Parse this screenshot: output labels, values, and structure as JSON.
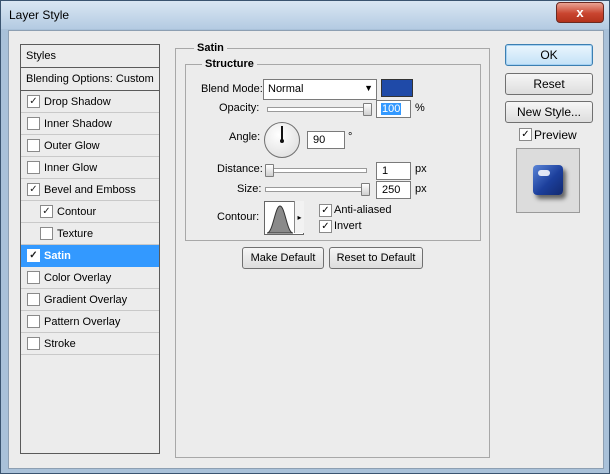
{
  "window": {
    "title": "Layer Style",
    "close_label": "x"
  },
  "styles": {
    "header": "Styles",
    "blending_options": "Blending Options: Custom",
    "items": [
      {
        "label": "Drop Shadow",
        "checked": true,
        "sub": false,
        "selected": false
      },
      {
        "label": "Inner Shadow",
        "checked": false,
        "sub": false,
        "selected": false
      },
      {
        "label": "Outer Glow",
        "checked": false,
        "sub": false,
        "selected": false
      },
      {
        "label": "Inner Glow",
        "checked": false,
        "sub": false,
        "selected": false
      },
      {
        "label": "Bevel and Emboss",
        "checked": true,
        "sub": false,
        "selected": false
      },
      {
        "label": "Contour",
        "checked": true,
        "sub": true,
        "selected": false
      },
      {
        "label": "Texture",
        "checked": false,
        "sub": true,
        "selected": false
      },
      {
        "label": "Satin",
        "checked": true,
        "sub": false,
        "selected": true
      },
      {
        "label": "Color Overlay",
        "checked": false,
        "sub": false,
        "selected": false
      },
      {
        "label": "Gradient Overlay",
        "checked": false,
        "sub": false,
        "selected": false
      },
      {
        "label": "Pattern Overlay",
        "checked": false,
        "sub": false,
        "selected": false
      },
      {
        "label": "Stroke",
        "checked": false,
        "sub": false,
        "selected": false
      }
    ]
  },
  "satin": {
    "group_title": "Satin",
    "structure_title": "Structure",
    "blend_mode_label": "Blend Mode:",
    "blend_mode_value": "Normal",
    "color": "#1f4aa8",
    "opacity_label": "Opacity:",
    "opacity_value": "100",
    "opacity_unit": "%",
    "opacity_fraction": 1.0,
    "angle_label": "Angle:",
    "angle_value": "90",
    "angle_unit": "°",
    "distance_label": "Distance:",
    "distance_value": "1",
    "distance_unit": "px",
    "distance_fraction": 0.0,
    "size_label": "Size:",
    "size_value": "250",
    "size_unit": "px",
    "size_fraction": 1.0,
    "contour_label": "Contour:",
    "anti_aliased_label": "Anti-aliased",
    "anti_aliased_checked": true,
    "invert_label": "Invert",
    "invert_checked": true,
    "make_default_label": "Make Default",
    "reset_default_label": "Reset to Default"
  },
  "actions": {
    "ok_label": "OK",
    "reset_label": "Reset",
    "new_style_label": "New Style...",
    "preview_label": "Preview",
    "preview_checked": true
  },
  "icons": {
    "check": "✓",
    "dropdown": "▼",
    "contour_arrow": "▸"
  }
}
